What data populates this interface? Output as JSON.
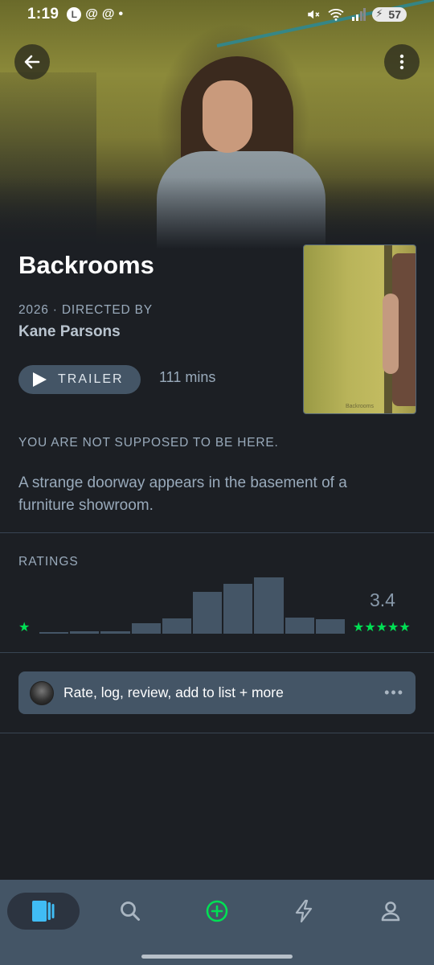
{
  "status_bar": {
    "time": "1:19",
    "left_icons": [
      "L",
      "@",
      "@",
      "•"
    ],
    "battery": "57"
  },
  "film": {
    "title": "Backrooms",
    "year": "2026",
    "directed_by_label": "DIRECTED BY",
    "director": "Kane Parsons",
    "trailer_label": "TRAILER",
    "runtime": "111 mins",
    "tagline": "YOU ARE NOT SUPPOSED TO BE HERE.",
    "synopsis": "A strange doorway appears in the basement of a furniture showroom.",
    "poster_caption": "Backrooms"
  },
  "ratings": {
    "label": "RATINGS",
    "low_star": "★",
    "high_stars": "★★★★★",
    "average": "3.4",
    "histogram": [
      0.02,
      0.04,
      0.05,
      0.18,
      0.27,
      0.74,
      0.89,
      1.0,
      0.29,
      0.26
    ]
  },
  "action_bar": {
    "label": "Rate, log, review, add to list + more",
    "more": "•••"
  },
  "bottom_nav": {
    "items": [
      "films-icon",
      "search-icon",
      "add-icon",
      "activity-icon",
      "profile-icon"
    ],
    "active": "films-icon"
  },
  "colors": {
    "background": "#1c1f24",
    "accent_green": "#00e054",
    "accent_blue": "#40bcf4",
    "slate": "#445566",
    "muted_text": "#99aabb"
  }
}
